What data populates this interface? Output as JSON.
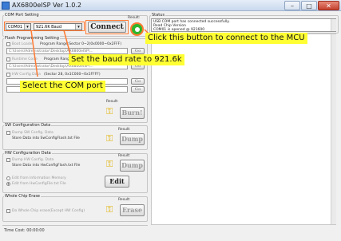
{
  "window": {
    "title": "AX6800eISP Ver 1.0.2",
    "min": "–",
    "max": "□",
    "close": "✕"
  },
  "com": {
    "group_label": "COM Port Setting",
    "port": "COM01",
    "baud": "921.6K Baud",
    "connect_label": "Connect",
    "result_label": "Result:"
  },
  "status": {
    "group_label": "Status",
    "lines": [
      "USB COM port has connected successfully.",
      "Read Chip Version",
      "COM01 is opened @ 921600"
    ]
  },
  "flash": {
    "group_label": "Flash Programming Setting",
    "boot_loader_label": "Boot Loader",
    "boot_loader_info": "Program Range:Sector 0~2(0x0000~0x2FFF)",
    "boot_loader_path": "C:\\Users\\Administrator\\Desktop\\AX6800eISP\\...",
    "runtime_label": "Runtime Code",
    "runtime_info": "Program Range:Sector 3~27(0x3000~0x1BFFF)",
    "runtime_path": "C:\\Users\\Administrator\\Desktop\\AX6800eISP\\...",
    "hw_config_label": "HW Config Data",
    "hw_config_info": "(Sector 28, 0x1C000~0x1FFFF)",
    "browse_label": "Go",
    "result_label": "Result:",
    "burn_label": "Burn!"
  },
  "sw1": {
    "group_label": "SW Configuration Data",
    "dump_check_label": "Dump SW Config. Data",
    "store_label": "Store Data into SwConfigFlash.txt File",
    "result_label": "Result:",
    "dump_label": "Dump"
  },
  "hw1": {
    "group_label": "HW Configuration Data",
    "dump_check_label": "Dump HW Config. Data",
    "store_label": "Store Data into HwConfigFlash.txt File",
    "result_label": "Result:",
    "dump_label": "Dump",
    "radio1_label": "Edit from Information Memory",
    "radio2_label": "Edit from HwConfigFile.txt File",
    "edit_label": "Edit"
  },
  "erase": {
    "group_label": "Whole Chip Erase",
    "check_label": "Do Whole Chip erase(Except HW Config)",
    "result_label": "Result:",
    "erase_label": "Erase"
  },
  "footer": {
    "time_cost": "Time Cost:  00:00:00"
  },
  "callouts": {
    "connect": "Click this button to connect to the MCU",
    "baud": "Set the baud rate to 921.6k",
    "port": "Select the COM port"
  },
  "colors": {
    "callout_bg": "#ffff33",
    "highlight": "#ff7a33",
    "ok_green": "#2db52d"
  }
}
